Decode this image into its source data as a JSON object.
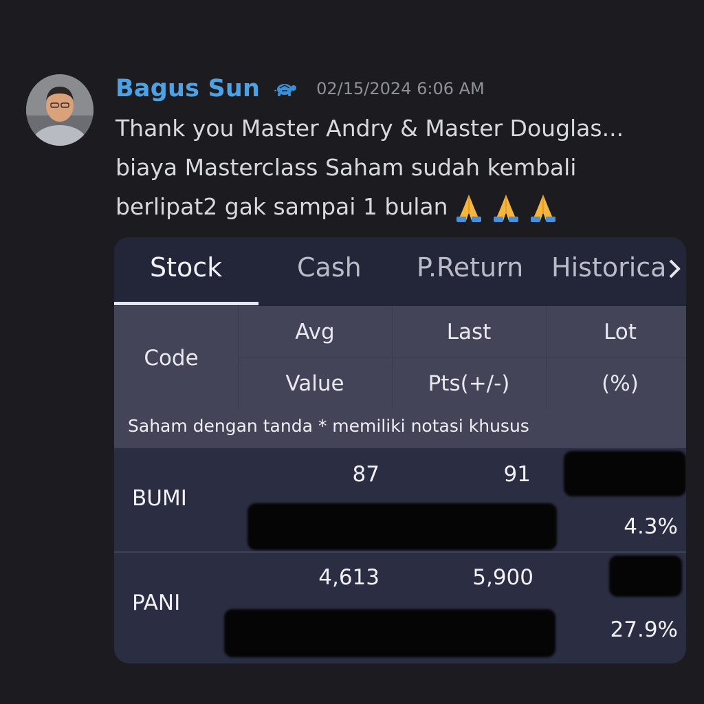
{
  "message": {
    "username": "Bagus Sun",
    "role_icon": "turtle-icon",
    "timestamp": "02/15/2024 6:06 AM",
    "lines": [
      "Thank you Master Andry & Master Douglas...",
      "biaya Masterclass Saham sudah kembali",
      "berlipat2 gak sampai 1 bulan"
    ],
    "emoji": "folded-hands-icon",
    "emoji_count": 3
  },
  "portfolio": {
    "tabs": [
      "Stock",
      "Cash",
      "P.Return",
      "Historical"
    ],
    "active_tab": "Stock",
    "columns": {
      "code": "Code",
      "avg": "Avg",
      "value": "Value",
      "last": "Last",
      "pts": "Pts(+/-)",
      "lot": "Lot",
      "pct": "(%)"
    },
    "note": "Saham dengan tanda * memiliki notasi khusus",
    "rows": [
      {
        "code": "BUMI",
        "avg": "87",
        "last": "91",
        "pct": "4.3%"
      },
      {
        "code": "PANI",
        "avg": "4,613",
        "last": "5,900",
        "pct": "27.9%"
      }
    ]
  },
  "colors": {
    "background": "#1c1c20",
    "username": "#4da2e6",
    "card": "#222437",
    "header": "#434458",
    "row": "#2b2d42"
  }
}
